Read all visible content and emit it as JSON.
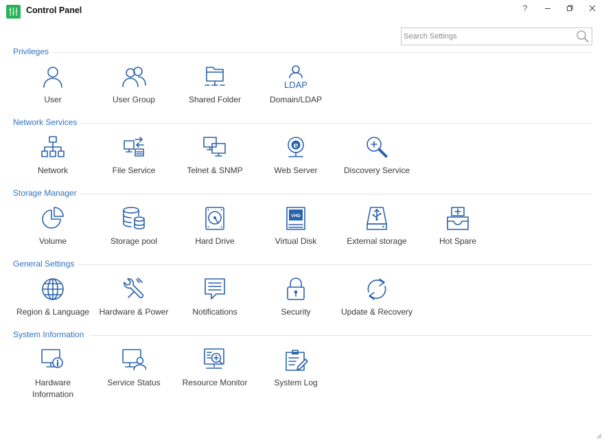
{
  "window": {
    "title": "Control Panel",
    "help_label": "?"
  },
  "search": {
    "placeholder": "Search Settings",
    "value": ""
  },
  "sections": [
    {
      "title": "Privileges",
      "items": [
        {
          "label": "User",
          "icon": "user-icon"
        },
        {
          "label": "User Group",
          "icon": "user-group-icon"
        },
        {
          "label": "Shared Folder",
          "icon": "shared-folder-icon"
        },
        {
          "label": "Domain/LDAP",
          "icon": "ldap-icon"
        }
      ]
    },
    {
      "title": "Network Services",
      "items": [
        {
          "label": "Network",
          "icon": "network-icon"
        },
        {
          "label": "File Service",
          "icon": "file-service-icon"
        },
        {
          "label": "Telnet & SNMP",
          "icon": "telnet-snmp-icon"
        },
        {
          "label": "Web Server",
          "icon": "web-server-icon"
        },
        {
          "label": "Discovery Service",
          "icon": "discovery-icon"
        }
      ]
    },
    {
      "title": "Storage Manager",
      "items": [
        {
          "label": "Volume",
          "icon": "volume-pie-icon"
        },
        {
          "label": "Storage pool",
          "icon": "storage-pool-icon"
        },
        {
          "label": "Hard Drive",
          "icon": "hard-drive-icon"
        },
        {
          "label": "Virtual Disk",
          "icon": "virtual-disk-icon",
          "badge": "VHD"
        },
        {
          "label": "External storage",
          "icon": "external-storage-icon"
        },
        {
          "label": "Hot Spare",
          "icon": "hot-spare-icon"
        }
      ]
    },
    {
      "title": "General Settings",
      "items": [
        {
          "label": "Region & Language",
          "icon": "globe-icon"
        },
        {
          "label": "Hardware & Power",
          "icon": "wrench-icon"
        },
        {
          "label": "Notifications",
          "icon": "notification-icon"
        },
        {
          "label": "Security",
          "icon": "lock-icon"
        },
        {
          "label": "Update & Recovery",
          "icon": "refresh-icon"
        }
      ]
    },
    {
      "title": "System Information",
      "items": [
        {
          "label": "Hardware\nInformation",
          "icon": "hardware-info-icon"
        },
        {
          "label": "Service Status",
          "icon": "service-status-icon"
        },
        {
          "label": "Resource Monitor",
          "icon": "resource-monitor-icon"
        },
        {
          "label": "System Log",
          "icon": "system-log-icon"
        }
      ]
    }
  ],
  "colors": {
    "accent": "#2d73c0",
    "icon": "#2a62ac",
    "logo": "#2bb15a"
  }
}
